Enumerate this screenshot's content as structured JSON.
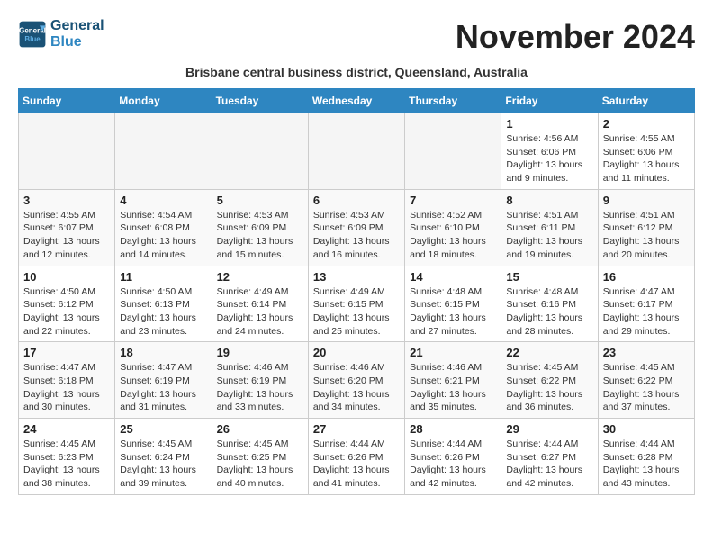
{
  "header": {
    "logo_line1": "General",
    "logo_line2": "Blue",
    "month_title": "November 2024",
    "subtitle": "Brisbane central business district, Queensland, Australia"
  },
  "weekdays": [
    "Sunday",
    "Monday",
    "Tuesday",
    "Wednesday",
    "Thursday",
    "Friday",
    "Saturday"
  ],
  "weeks": [
    [
      {
        "day": "",
        "info": ""
      },
      {
        "day": "",
        "info": ""
      },
      {
        "day": "",
        "info": ""
      },
      {
        "day": "",
        "info": ""
      },
      {
        "day": "",
        "info": ""
      },
      {
        "day": "1",
        "info": "Sunrise: 4:56 AM\nSunset: 6:06 PM\nDaylight: 13 hours\nand 9 minutes."
      },
      {
        "day": "2",
        "info": "Sunrise: 4:55 AM\nSunset: 6:06 PM\nDaylight: 13 hours\nand 11 minutes."
      }
    ],
    [
      {
        "day": "3",
        "info": "Sunrise: 4:55 AM\nSunset: 6:07 PM\nDaylight: 13 hours\nand 12 minutes."
      },
      {
        "day": "4",
        "info": "Sunrise: 4:54 AM\nSunset: 6:08 PM\nDaylight: 13 hours\nand 14 minutes."
      },
      {
        "day": "5",
        "info": "Sunrise: 4:53 AM\nSunset: 6:09 PM\nDaylight: 13 hours\nand 15 minutes."
      },
      {
        "day": "6",
        "info": "Sunrise: 4:53 AM\nSunset: 6:09 PM\nDaylight: 13 hours\nand 16 minutes."
      },
      {
        "day": "7",
        "info": "Sunrise: 4:52 AM\nSunset: 6:10 PM\nDaylight: 13 hours\nand 18 minutes."
      },
      {
        "day": "8",
        "info": "Sunrise: 4:51 AM\nSunset: 6:11 PM\nDaylight: 13 hours\nand 19 minutes."
      },
      {
        "day": "9",
        "info": "Sunrise: 4:51 AM\nSunset: 6:12 PM\nDaylight: 13 hours\nand 20 minutes."
      }
    ],
    [
      {
        "day": "10",
        "info": "Sunrise: 4:50 AM\nSunset: 6:12 PM\nDaylight: 13 hours\nand 22 minutes."
      },
      {
        "day": "11",
        "info": "Sunrise: 4:50 AM\nSunset: 6:13 PM\nDaylight: 13 hours\nand 23 minutes."
      },
      {
        "day": "12",
        "info": "Sunrise: 4:49 AM\nSunset: 6:14 PM\nDaylight: 13 hours\nand 24 minutes."
      },
      {
        "day": "13",
        "info": "Sunrise: 4:49 AM\nSunset: 6:15 PM\nDaylight: 13 hours\nand 25 minutes."
      },
      {
        "day": "14",
        "info": "Sunrise: 4:48 AM\nSunset: 6:15 PM\nDaylight: 13 hours\nand 27 minutes."
      },
      {
        "day": "15",
        "info": "Sunrise: 4:48 AM\nSunset: 6:16 PM\nDaylight: 13 hours\nand 28 minutes."
      },
      {
        "day": "16",
        "info": "Sunrise: 4:47 AM\nSunset: 6:17 PM\nDaylight: 13 hours\nand 29 minutes."
      }
    ],
    [
      {
        "day": "17",
        "info": "Sunrise: 4:47 AM\nSunset: 6:18 PM\nDaylight: 13 hours\nand 30 minutes."
      },
      {
        "day": "18",
        "info": "Sunrise: 4:47 AM\nSunset: 6:19 PM\nDaylight: 13 hours\nand 31 minutes."
      },
      {
        "day": "19",
        "info": "Sunrise: 4:46 AM\nSunset: 6:19 PM\nDaylight: 13 hours\nand 33 minutes."
      },
      {
        "day": "20",
        "info": "Sunrise: 4:46 AM\nSunset: 6:20 PM\nDaylight: 13 hours\nand 34 minutes."
      },
      {
        "day": "21",
        "info": "Sunrise: 4:46 AM\nSunset: 6:21 PM\nDaylight: 13 hours\nand 35 minutes."
      },
      {
        "day": "22",
        "info": "Sunrise: 4:45 AM\nSunset: 6:22 PM\nDaylight: 13 hours\nand 36 minutes."
      },
      {
        "day": "23",
        "info": "Sunrise: 4:45 AM\nSunset: 6:22 PM\nDaylight: 13 hours\nand 37 minutes."
      }
    ],
    [
      {
        "day": "24",
        "info": "Sunrise: 4:45 AM\nSunset: 6:23 PM\nDaylight: 13 hours\nand 38 minutes."
      },
      {
        "day": "25",
        "info": "Sunrise: 4:45 AM\nSunset: 6:24 PM\nDaylight: 13 hours\nand 39 minutes."
      },
      {
        "day": "26",
        "info": "Sunrise: 4:45 AM\nSunset: 6:25 PM\nDaylight: 13 hours\nand 40 minutes."
      },
      {
        "day": "27",
        "info": "Sunrise: 4:44 AM\nSunset: 6:26 PM\nDaylight: 13 hours\nand 41 minutes."
      },
      {
        "day": "28",
        "info": "Sunrise: 4:44 AM\nSunset: 6:26 PM\nDaylight: 13 hours\nand 42 minutes."
      },
      {
        "day": "29",
        "info": "Sunrise: 4:44 AM\nSunset: 6:27 PM\nDaylight: 13 hours\nand 42 minutes."
      },
      {
        "day": "30",
        "info": "Sunrise: 4:44 AM\nSunset: 6:28 PM\nDaylight: 13 hours\nand 43 minutes."
      }
    ]
  ]
}
